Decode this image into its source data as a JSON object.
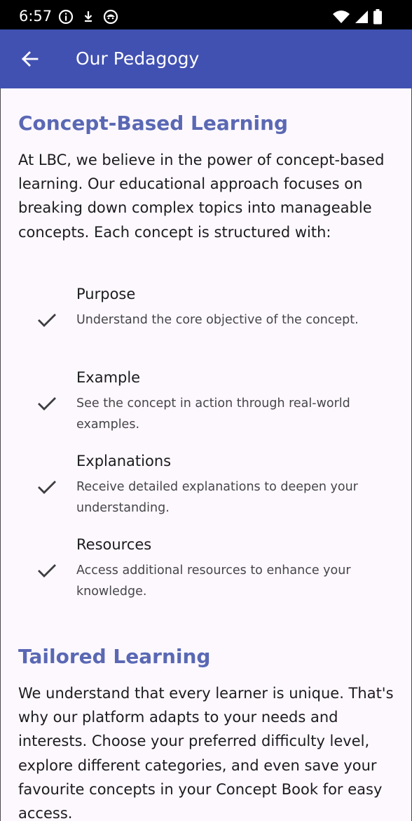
{
  "status_bar": {
    "time": "6:57"
  },
  "app_bar": {
    "title": "Our Pedagogy"
  },
  "sections": [
    {
      "title": "Concept-Based Learning",
      "body": "At LBC, we believe in the power of concept-based learning. Our educational approach focuses on breaking down complex topics into manageable concepts. Each concept is structured with:",
      "features": [
        {
          "title": "Purpose",
          "desc": "Understand the core objective of the concept."
        },
        {
          "title": "Example",
          "desc": "See the concept in action through real-world examples."
        },
        {
          "title": "Explanations",
          "desc": "Receive detailed explanations to deepen your understanding."
        },
        {
          "title": "Resources",
          "desc": "Access additional resources to enhance your knowledge."
        }
      ]
    },
    {
      "title": "Tailored Learning",
      "body": "We understand that every learner is unique. That's why our platform adapts to your needs and interests. Choose your preferred difficulty level, explore different categories, and even save your favourite concepts in your Concept Book for easy access."
    }
  ],
  "colors": {
    "app_bar": "#4151b1",
    "section_title": "#5a68b4",
    "background": "#fdf8fd"
  }
}
